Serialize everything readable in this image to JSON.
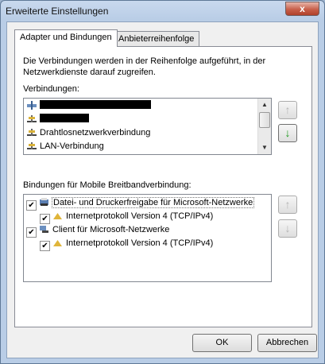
{
  "window": {
    "title": "Erweiterte Einstellungen",
    "close_label": "x"
  },
  "tabs": [
    {
      "label": "Adapter und Bindungen",
      "active": true
    },
    {
      "label": "Anbieterreihenfolge",
      "active": false
    }
  ],
  "description": "Die Verbindungen werden in der Reihenfolge aufgeführt, in der Netzwerkdienste darauf zugreifen.",
  "connections": {
    "label": "Verbindungen:",
    "items": [
      {
        "label": "",
        "redacted": true,
        "icon": "network-adapter-icon"
      },
      {
        "label": "",
        "redacted": true,
        "icon": "network-adapter-icon"
      },
      {
        "label": "Drahtlosnetzwerkverbindung",
        "icon": "network-adapter-icon"
      },
      {
        "label": "LAN-Verbindung",
        "icon": "network-adapter-icon"
      }
    ],
    "up_glyph": "↑",
    "down_glyph": "↓"
  },
  "bindings": {
    "label": "Bindungen für Mobile Breitbandverbindung:",
    "items": [
      {
        "label": "Datei- und Druckerfreigabe für Microsoft-Netzwerke",
        "checked": true,
        "level": 0,
        "icon": "file-printer-sharing-icon",
        "selected": true
      },
      {
        "label": "Internetprotokoll Version 4 (TCP/IPv4)",
        "checked": true,
        "level": 1,
        "icon": "protocol-icon"
      },
      {
        "label": "Client für Microsoft-Netzwerke",
        "checked": true,
        "level": 0,
        "icon": "network-client-icon"
      },
      {
        "label": "Internetprotokoll Version 4 (TCP/IPv4)",
        "checked": true,
        "level": 1,
        "icon": "protocol-icon"
      }
    ],
    "up_glyph": "↑",
    "down_glyph": "↓"
  },
  "buttons": {
    "ok": "OK",
    "cancel": "Abbrechen"
  },
  "colors": {
    "accent_green": "#1e9a1e",
    "close_red": "#c8604a"
  }
}
